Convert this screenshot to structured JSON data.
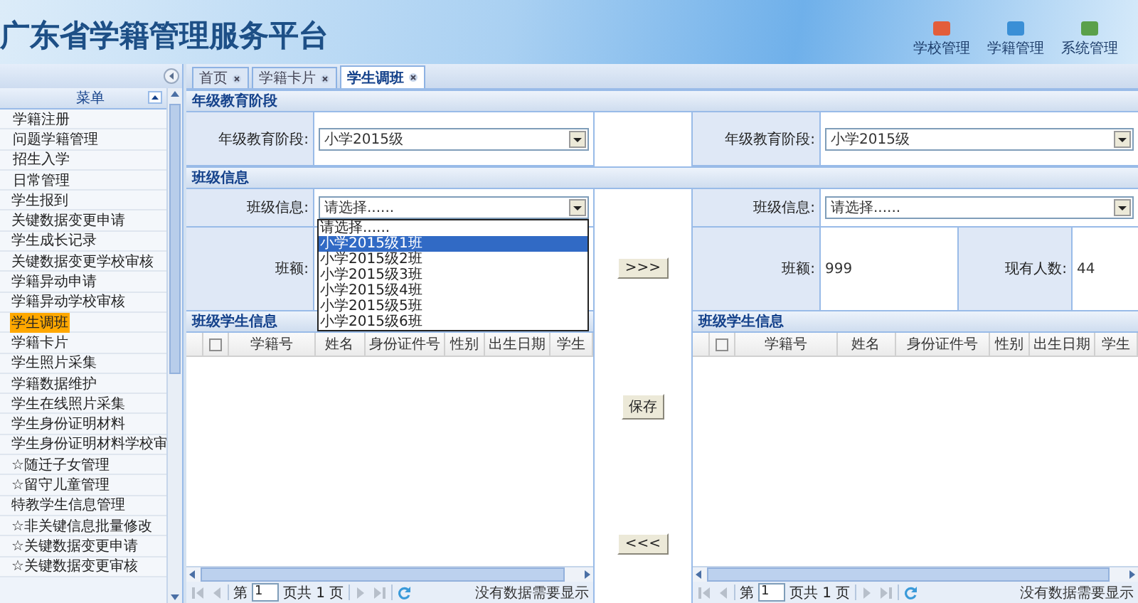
{
  "header": {
    "title": "广东省学籍管理服务平台",
    "nav": [
      {
        "label": "学校管理"
      },
      {
        "label": "学籍管理"
      },
      {
        "label": "系统管理"
      }
    ]
  },
  "sidebar": {
    "title": "菜单",
    "items": [
      {
        "label": "学籍注册",
        "selected": false
      },
      {
        "label": "问题学籍管理",
        "selected": false
      },
      {
        "label": "招生入学",
        "selected": false
      },
      {
        "label": "日常管理",
        "selected": false,
        "children": [
          {
            "label": "学生报到",
            "selected": false
          },
          {
            "label": "关键数据变更申请",
            "selected": false
          },
          {
            "label": "学生成长记录",
            "selected": false
          },
          {
            "label": "关键数据变更学校审核",
            "selected": false
          },
          {
            "label": "学籍异动申请",
            "selected": false
          },
          {
            "label": "学籍异动学校审核",
            "selected": false
          },
          {
            "label": "学生调班",
            "selected": true
          },
          {
            "label": "学籍卡片",
            "selected": false
          },
          {
            "label": "学生照片采集",
            "selected": false
          },
          {
            "label": "学籍数据维护",
            "selected": false
          },
          {
            "label": "学生在线照片采集",
            "selected": false
          },
          {
            "label": "学生身份证明材料",
            "selected": false
          },
          {
            "label": "学生身份证明材料学校审",
            "selected": false
          },
          {
            "label": "☆随迁子女管理",
            "selected": false
          },
          {
            "label": "☆留守儿童管理",
            "selected": false
          },
          {
            "label": "特教学生信息管理",
            "selected": false
          },
          {
            "label": "☆非关键信息批量修改",
            "selected": false
          },
          {
            "label": "☆关键数据变更申请",
            "selected": false
          },
          {
            "label": "☆关键数据变更审核",
            "selected": false
          }
        ]
      }
    ]
  },
  "tabs": [
    {
      "label": "首页",
      "selected": false
    },
    {
      "label": "学籍卡片",
      "selected": false
    },
    {
      "label": "学生调班",
      "selected": true
    }
  ],
  "grade_section": {
    "title": "年级教育阶段",
    "left": {
      "label": "年级教育阶段:",
      "value": "小学2015级"
    },
    "right": {
      "label": "年级教育阶段:",
      "value": "小学2015级"
    }
  },
  "class_section": {
    "title": "班级信息",
    "left": {
      "class_label": "班级信息:",
      "class_value": "请选择......",
      "size_label": "班额:",
      "dropdown": [
        {
          "label": "请选择......",
          "selected": false
        },
        {
          "label": "小学2015级1班",
          "selected": true
        },
        {
          "label": "小学2015级2班",
          "selected": false
        },
        {
          "label": "小学2015级3班",
          "selected": false
        },
        {
          "label": "小学2015级4班",
          "selected": false
        },
        {
          "label": "小学2015级5班",
          "selected": false
        },
        {
          "label": "小学2015级6班",
          "selected": false
        }
      ],
      "students": {
        "title": "班级学生信息",
        "select_all_checked": false,
        "columns": [
          "学籍号",
          "姓名",
          "身份证件号",
          "性别",
          "出生日期",
          "学生"
        ],
        "pager": {
          "page_prefix": "第",
          "page": "1",
          "page_suffix": "页共 1 页",
          "status": "没有数据需要显示"
        }
      }
    },
    "right": {
      "class_label": "班级信息:",
      "class_value": "请选择......",
      "size_label": "班额:",
      "size_value": "999",
      "count_label": "现有人数:",
      "count_value": "44",
      "students": {
        "title": "班级学生信息",
        "select_all_checked": false,
        "columns": [
          "学籍号",
          "姓名",
          "身份证件号",
          "性别",
          "出生日期",
          "学生"
        ],
        "pager": {
          "page_prefix": "第",
          "page": "1",
          "page_suffix": "页共 1 页",
          "status": "没有数据需要显示"
        }
      }
    }
  },
  "transfer_buttons": [
    ">>>",
    "保存",
    "<<<"
  ]
}
